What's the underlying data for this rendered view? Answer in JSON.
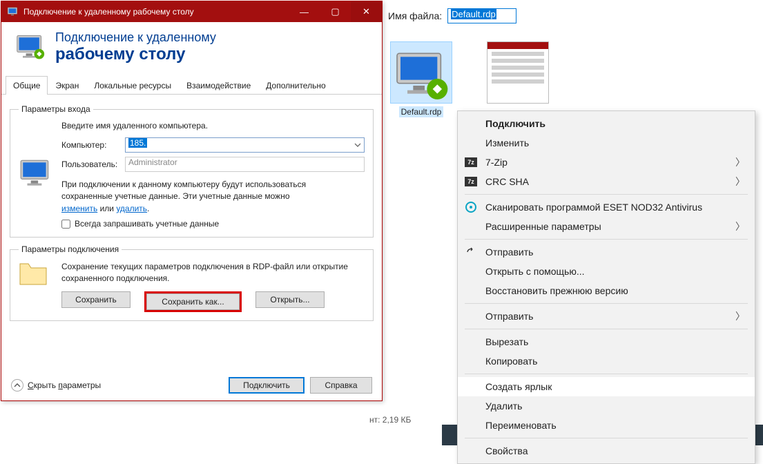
{
  "window": {
    "title": "Подключение к удаленному рабочему столу",
    "header_line1": "Подключение к удаленному",
    "header_line2": "рабочему столу"
  },
  "tabs": [
    "Общие",
    "Экран",
    "Локальные ресурсы",
    "Взаимодействие",
    "Дополнительно"
  ],
  "login": {
    "legend": "Параметры входа",
    "instruction": "Введите имя удаленного компьютера.",
    "computer_label": "Компьютер:",
    "computer_value": "185.",
    "user_label": "Пользователь:",
    "user_value": "Administrator",
    "note_pre": "При подключении к данному компьютеру будут использоваться сохраненные учетные данные. Эти учетные данные можно ",
    "note_link1": "изменить",
    "note_mid": " или ",
    "note_link2": "удалить",
    "note_post": ".",
    "checkbox_label": "Всегда запрашивать учетные данные"
  },
  "conn": {
    "legend": "Параметры подключения",
    "desc": "Сохранение текущих параметров подключения в RDP-файл или открытие сохраненного подключения.",
    "save": "Сохранить",
    "save_as": "Сохранить как...",
    "open": "Открыть..."
  },
  "footer": {
    "hide_params": "Скрыть параметры",
    "connect": "Подключить",
    "help": "Справка"
  },
  "explorer": {
    "filename_label": "Имя файла:",
    "filename_value": "Default.rdp",
    "file1_label": "Default.rdp",
    "size_hint": "нт: 2,19 КБ"
  },
  "menu": {
    "connect": "Подключить",
    "edit": "Изменить",
    "sevenzip": "7-Zip",
    "crcsha": "CRC SHA",
    "eset": "Сканировать программой ESET NOD32 Antivirus",
    "advanced_params": "Расширенные параметры",
    "send": "Отправить",
    "open_with": "Открыть с помощью...",
    "restore_prev": "Восстановить прежнюю версию",
    "send2": "Отправить",
    "cut": "Вырезать",
    "copy": "Копировать",
    "create_shortcut": "Создать ярлык",
    "delete": "Удалить",
    "rename": "Переименовать",
    "properties": "Свойства"
  }
}
